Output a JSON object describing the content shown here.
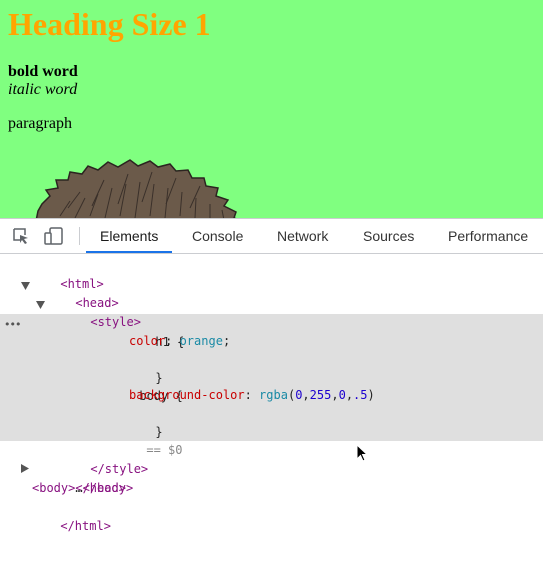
{
  "page": {
    "heading": "Heading Size 1",
    "bold": "bold word",
    "italic": "italic word",
    "paragraph": "paragraph",
    "background_color": "#80ff80",
    "heading_color": "#ffa500"
  },
  "devtools": {
    "tabs": [
      {
        "label": "Elements",
        "active": true
      },
      {
        "label": "Console",
        "active": false
      },
      {
        "label": "Network",
        "active": false
      },
      {
        "label": "Sources",
        "active": false
      },
      {
        "label": "Performance",
        "active": false
      }
    ],
    "icons": [
      "inspect-element-icon",
      "device-toolbar-icon"
    ],
    "accent": "#1a73e8",
    "tree": {
      "html_open": "<html>",
      "head_open": "<head>",
      "style_open": "<style>",
      "css": {
        "h1_selector": "h1 {",
        "h1_prop": "color",
        "h1_value": "orange",
        "close1": "}",
        "body_selector": "body {",
        "body_prop": "background-color",
        "rgba_fn": "rgba",
        "rgba_args": [
          "0",
          "255",
          "0",
          ".5"
        ],
        "close2": "}"
      },
      "selected_marker": "== $0",
      "style_close": "</style>",
      "head_close": "</head>",
      "body_open": "<body>",
      "body_ellipsis": "…",
      "body_close": "</body>",
      "html_close": "</html>"
    }
  }
}
